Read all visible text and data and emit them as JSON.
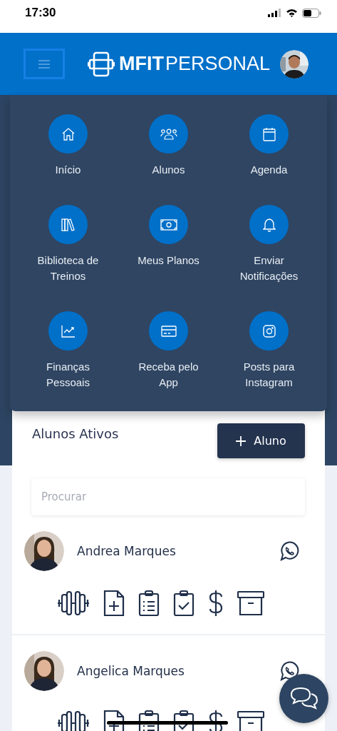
{
  "status_bar": {
    "time": "17:30"
  },
  "header": {
    "logo_bold": "MFIT",
    "logo_light": "PERSONAL"
  },
  "menu": {
    "items": [
      {
        "label": "Início",
        "kind": "home"
      },
      {
        "label": "Alunos",
        "kind": "people"
      },
      {
        "label": "Agenda",
        "kind": "calendar"
      },
      {
        "label": "Biblioteca de Treinos",
        "kind": "books"
      },
      {
        "label": "Meus Planos",
        "kind": "money"
      },
      {
        "label": "Enviar Notificações",
        "kind": "bell"
      },
      {
        "label": "Finanças Pessoais",
        "kind": "chart"
      },
      {
        "label": "Receba pelo App",
        "kind": "card"
      },
      {
        "label": "Posts para Instagram",
        "kind": "camera"
      }
    ]
  },
  "students_panel": {
    "title": "Alunos Ativos",
    "add_button": "Aluno",
    "search": {
      "placeholder": "Procurar"
    },
    "students": [
      {
        "name": "Andrea Marques"
      },
      {
        "name": "Angelica Marques"
      }
    ]
  }
}
